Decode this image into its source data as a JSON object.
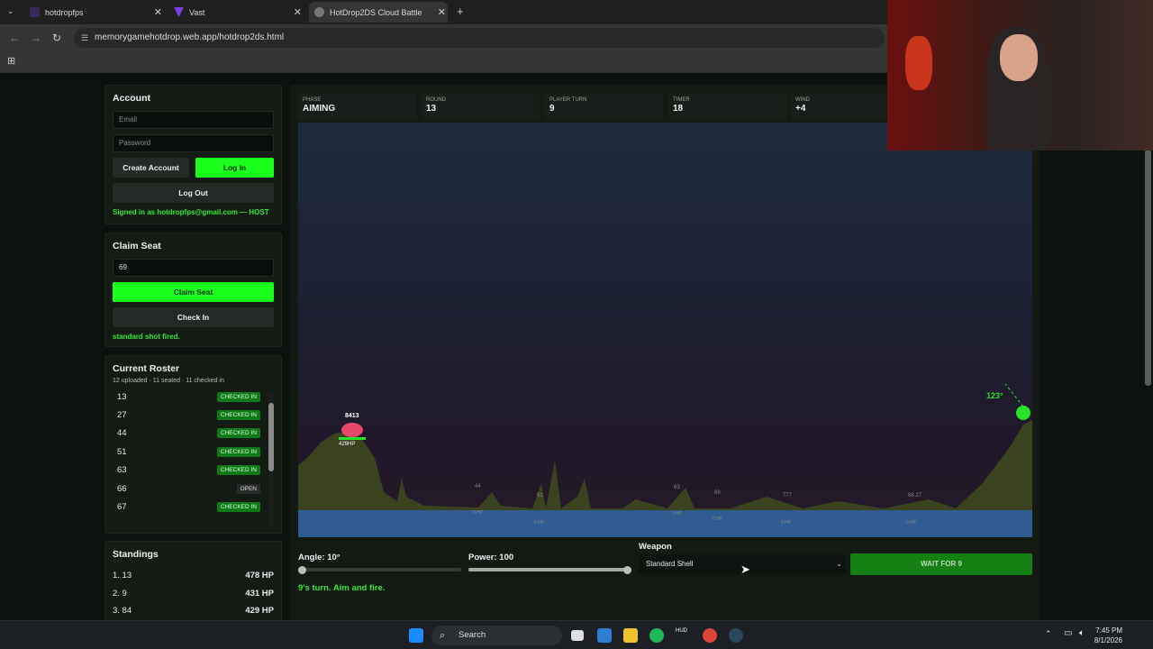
{
  "browser": {
    "tabs": [
      {
        "label": "hotdropfps"
      },
      {
        "label": "Vast"
      },
      {
        "label": "HotDrop2DS Cloud Battle"
      }
    ],
    "url": "memorygamehotdrop.web.app/hotdrop2ds.html",
    "new_tab_label": "+"
  },
  "account": {
    "title": "Account",
    "email_placeholder": "Email",
    "password_placeholder": "Password",
    "create_label": "Create Account",
    "login_label": "Log In",
    "logout_label": "Log Out",
    "status": "Signed in as hotdropfps@gmail.com — HOST"
  },
  "claim": {
    "title": "Claim Seat",
    "seat_value": "69",
    "claim_label": "Claim Seat",
    "checkin_label": "Check In",
    "status": "standard shot fired."
  },
  "roster": {
    "title": "Current Roster",
    "summary": "12 uploaded · 11 seated · 11 checked in",
    "rows": [
      {
        "seat": "13",
        "status": "CHECKED IN"
      },
      {
        "seat": "27",
        "status": "CHECKED IN"
      },
      {
        "seat": "44",
        "status": "CHECKED IN"
      },
      {
        "seat": "51",
        "status": "CHECKED IN"
      },
      {
        "seat": "63",
        "status": "CHECKED IN"
      },
      {
        "seat": "66",
        "status": "OPEN"
      },
      {
        "seat": "67",
        "status": "CHECKED IN"
      }
    ]
  },
  "standings": {
    "title": "Standings",
    "rows": [
      {
        "rank": "1. 13",
        "hp": "478 HP"
      },
      {
        "rank": "2. 9",
        "hp": "431 HP"
      },
      {
        "rank": "3. 84",
        "hp": "429 HP"
      }
    ]
  },
  "stats": [
    {
      "label": "PHASE",
      "value": "AIMING"
    },
    {
      "label": "ROUND",
      "value": "13"
    },
    {
      "label": "PLAYER TURN",
      "value": "9"
    },
    {
      "label": "TIMER",
      "value": "18"
    },
    {
      "label": "WIND",
      "value": "+4"
    }
  ],
  "game": {
    "left_tank_label": "8413",
    "left_tank_hp": "429HP",
    "right_tank_angle": "123°",
    "ghosts": [
      "44",
      "51",
      "63",
      "69",
      "777",
      "88 27"
    ],
    "ghost_hp": "0 HP"
  },
  "controls": {
    "angle_label": "Angle: 10°",
    "angle_value": 10,
    "power_label": "Power: 100",
    "power_value": 100,
    "weapon_label": "Weapon",
    "weapon_selected": "Standard Shell",
    "fire_label": "WAIT FOR 9",
    "turn_message": "9's turn. Aim and fire."
  },
  "taskbar": {
    "search_label": "Search",
    "time": "7:45 PM",
    "date": "8/1/2026"
  },
  "colors": {
    "accent_green": "#19ff1b",
    "badge_green": "#0e7a18",
    "left_tank": "#e8486a",
    "right_tank": "#28e428"
  }
}
